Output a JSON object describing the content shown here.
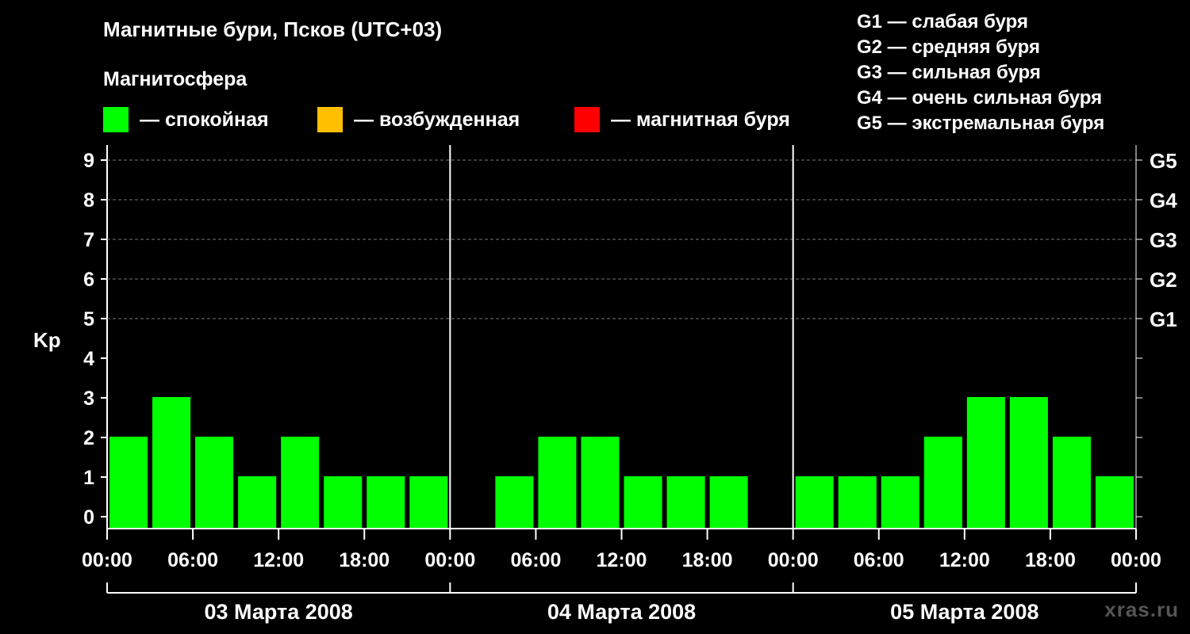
{
  "title": "Магнитные бури, Псков (UTC+03)",
  "subtitle": "Магнитосфера",
  "legend": [
    {
      "color": "#00ff00",
      "label": "— спокойная"
    },
    {
      "color": "#ffbf00",
      "label": "— возбужденная"
    },
    {
      "color": "#ff0000",
      "label": "— магнитная буря"
    }
  ],
  "g_legend": [
    "G1 — слабая буря",
    "G2 — средняя буря",
    "G3 — сильная буря",
    "G4 — очень сильная буря",
    "G5 — экстремальная буря"
  ],
  "watermark": "xras.ru",
  "chart_data": {
    "type": "bar",
    "ylabel": "Kp",
    "ylim": [
      0,
      9
    ],
    "yticks": [
      0,
      1,
      2,
      3,
      4,
      5,
      6,
      7,
      8,
      9
    ],
    "right_axis_labels": [
      {
        "kp": 5,
        "label": "G1"
      },
      {
        "kp": 6,
        "label": "G2"
      },
      {
        "kp": 7,
        "label": "G3"
      },
      {
        "kp": 8,
        "label": "G4"
      },
      {
        "kp": 9,
        "label": "G5"
      }
    ],
    "x_tick_labels": [
      "00:00",
      "06:00",
      "12:00",
      "18:00",
      "00:00",
      "06:00",
      "12:00",
      "18:00",
      "00:00",
      "06:00",
      "12:00",
      "18:00",
      "00:00"
    ],
    "days": [
      {
        "label": "03 Марта 2008",
        "values": [
          2,
          3,
          2,
          1,
          2,
          1,
          1,
          1
        ]
      },
      {
        "label": "04 Марта 2008",
        "values": [
          0,
          1,
          2,
          2,
          1,
          1,
          1,
          0
        ]
      },
      {
        "label": "05 Марта 2008",
        "values": [
          1,
          1,
          1,
          2,
          3,
          3,
          2,
          1
        ]
      }
    ],
    "interval_hours": 3,
    "bar_color": "#00ff00",
    "grid": "dashed horizontal at Kp 5-9"
  }
}
